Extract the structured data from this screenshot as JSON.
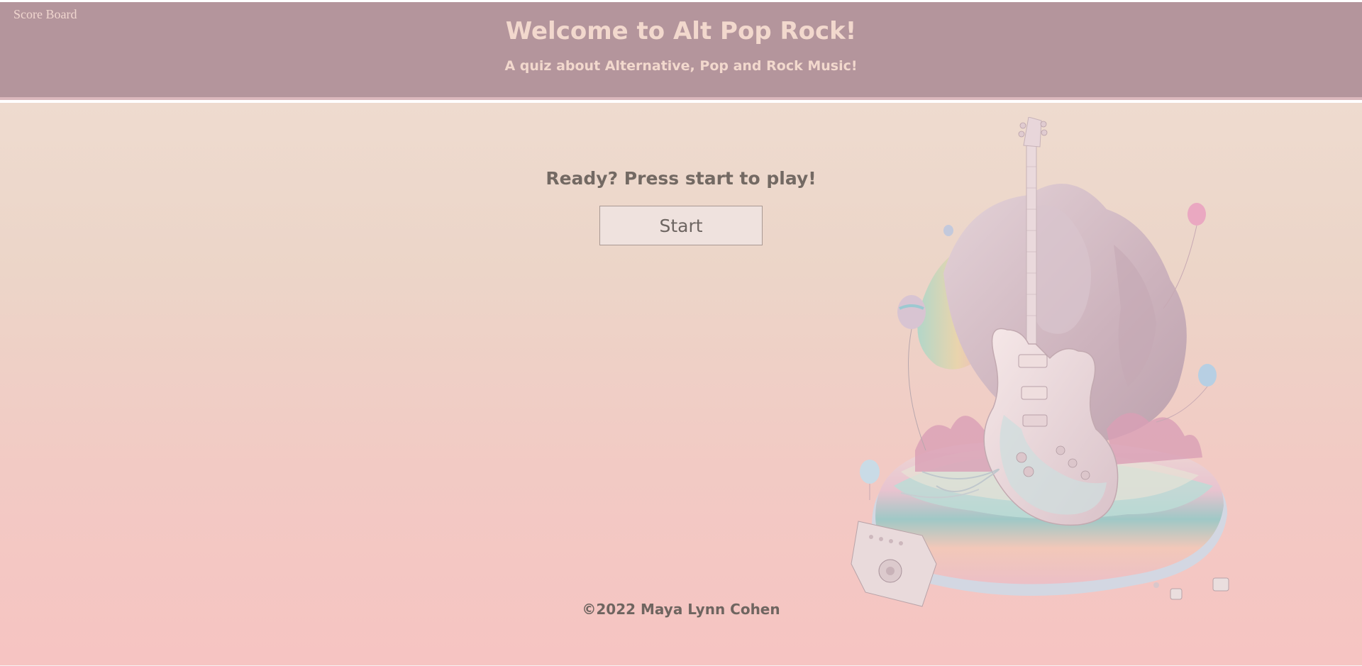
{
  "header": {
    "scoreboard_link": "Score Board",
    "title": "Welcome to Alt Pop Rock!",
    "subtitle": "A quiz about Alternative, Pop and Rock Music!"
  },
  "main": {
    "prompt": "Ready? Press start to play!",
    "start_button": "Start"
  },
  "footer": {
    "copyright": "©2022 Maya Lynn Cohen"
  },
  "illustration": {
    "subject": "pastel guitar on rock island with balloons"
  },
  "colors": {
    "header_bg": "#b4959c",
    "header_text": "#f2d8cd",
    "page_bg_top": "#eedbcf",
    "page_bg_bottom": "#f6c4c2",
    "body_text": "#736963",
    "button_bg": "#efe2de"
  }
}
